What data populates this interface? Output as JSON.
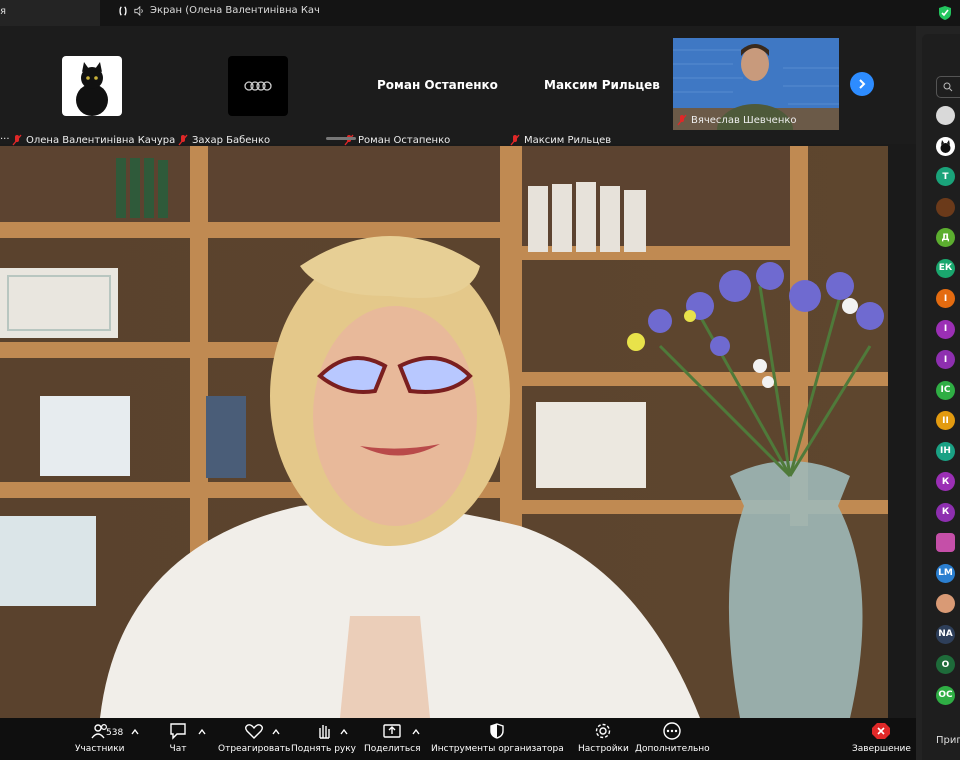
{
  "window": {
    "left_tab_text": "я",
    "share_title": "Экран (Олена Валентинівна Кач"
  },
  "gallery": {
    "tiles": [
      {
        "name": "Олена Валентинівна Качура",
        "avatar": "black-cat"
      },
      {
        "name": "Захар Бабенко",
        "avatar": "audi-logo"
      },
      {
        "name": "Роман Остапенко",
        "display": "Роман Остапенко"
      },
      {
        "name": "Максим Рильцев",
        "display": "Максим Рильцев"
      },
      {
        "name": "Вячеслав Шевченко",
        "video": true
      }
    ],
    "left_truncated": "...",
    "next_icon": "chevron-right-icon"
  },
  "sidebar": {
    "search_icon": "search-icon",
    "avatars": [
      {
        "initials": "",
        "color": "#d9d9d9",
        "kind": "photo"
      },
      {
        "initials": "",
        "color": "#ffffff",
        "kind": "cat"
      },
      {
        "initials": "Т",
        "color": "#1aa37a"
      },
      {
        "initials": "",
        "color": "#6b3a1a",
        "kind": "photo"
      },
      {
        "initials": "Д",
        "color": "#5cae2f"
      },
      {
        "initials": "ЕК",
        "color": "#1aa76e"
      },
      {
        "initials": "І",
        "color": "#e46b10"
      },
      {
        "initials": "І",
        "color": "#9b2fb5"
      },
      {
        "initials": "І",
        "color": "#8e2fb0"
      },
      {
        "initials": "ІС",
        "color": "#2fae44"
      },
      {
        "initials": "ІІ",
        "color": "#e39b10"
      },
      {
        "initials": "ІН",
        "color": "#1aa184"
      },
      {
        "initials": "К",
        "color": "#9b2fb5"
      },
      {
        "initials": "К",
        "color": "#8e2fb0"
      },
      {
        "initials": "",
        "color": "#c54fa8",
        "kind": "flower"
      },
      {
        "initials": "LM",
        "color": "#2b7fd0"
      },
      {
        "initials": "",
        "color": "#d99a75",
        "kind": "photo"
      },
      {
        "initials": "NA",
        "color": "#2e3f5a"
      },
      {
        "initials": "О",
        "color": "#1e6b3a"
      },
      {
        "initials": "ОС",
        "color": "#2fae44"
      }
    ],
    "invite_text": "Пригл"
  },
  "toolbar": {
    "participants_label": "Участники",
    "participants_count": "538",
    "chat_label": "Чат",
    "react_label": "Отреагировать",
    "raise_hand_label": "Поднять руку",
    "share_label": "Поделиться",
    "host_tools_label": "Инструменты организатора",
    "settings_label": "Настройки",
    "more_label": "Дополнительно",
    "end_label": "Завершение"
  },
  "colors": {
    "accent": "#2d8cff",
    "end": "#e02828",
    "muted_mic": "#e02828"
  }
}
